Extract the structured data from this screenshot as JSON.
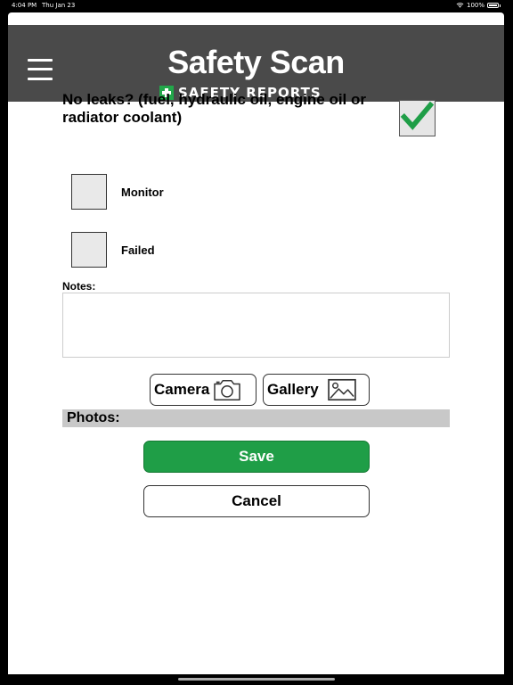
{
  "status_bar": {
    "time": "4:04 PM",
    "date": "Thu Jan 23",
    "battery": "100%"
  },
  "header": {
    "title": "Safety Scan",
    "brand": "SAFETY REPORTS",
    "menu_icon": "hamburger-menu-icon"
  },
  "colors": {
    "header_bg": "#4a4a4a",
    "accent_green": "#1f9e47",
    "check_green": "#22a74a",
    "photos_bar": "#c8c8c8"
  },
  "inspection": {
    "question": "No leaks? (fuel, hydraulic oil, engine oil or radiator coolant)",
    "passed": true,
    "options": [
      {
        "label": "Monitor",
        "checked": false
      },
      {
        "label": "Failed",
        "checked": false
      }
    ]
  },
  "notes": {
    "label": "Notes:",
    "value": ""
  },
  "media": {
    "camera_label": "Camera",
    "camera_icon": "camera-icon",
    "gallery_label": "Gallery",
    "gallery_icon": "image-icon"
  },
  "photos": {
    "label": "Photos:"
  },
  "actions": {
    "save_label": "Save",
    "cancel_label": "Cancel"
  }
}
